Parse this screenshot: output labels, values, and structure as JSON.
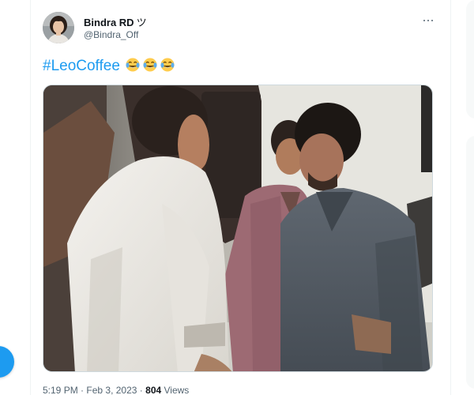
{
  "author": {
    "display_name": "Bindra RD",
    "name_suffix": "ツ",
    "handle": "@Bindra_Off",
    "avatar_icon": "profile-avatar"
  },
  "more_icon": "more-horizontal-icon",
  "tweet": {
    "hashtag": "#LeoCoffee",
    "emojis": [
      "face-with-tears-of-joy",
      "face-with-tears-of-joy",
      "face-with-tears-of-joy"
    ]
  },
  "media": {
    "type": "video-still",
    "icon": "tweet-media-image"
  },
  "meta": {
    "time": "5:19 PM",
    "separator": "·",
    "date": "Feb 3, 2023",
    "views_count": "804",
    "views_label": "Views"
  },
  "colors": {
    "link_blue": "#1d9bf0",
    "secondary_text": "#536471",
    "primary_text": "#0f1419",
    "border": "#cfd9de"
  }
}
